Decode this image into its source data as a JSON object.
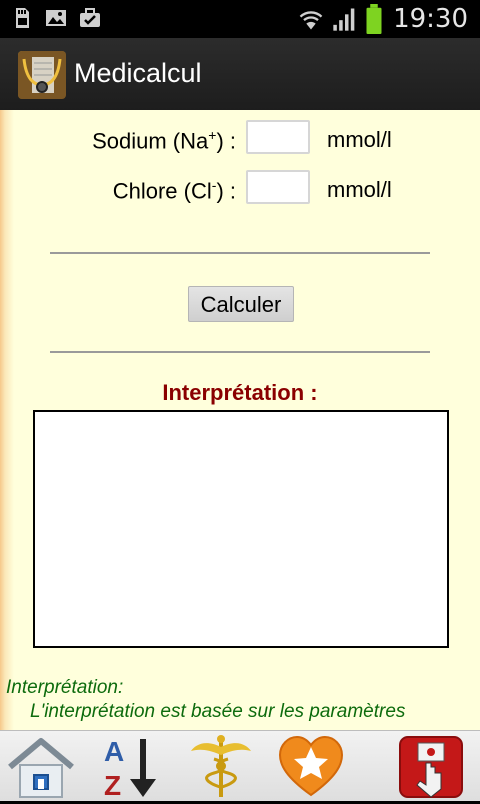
{
  "status_bar": {
    "time": "19:30",
    "icons": [
      "sd-card-icon",
      "image-icon",
      "briefcase-check-icon",
      "wifi-icon",
      "signal-icon",
      "battery-icon"
    ],
    "battery_color": "#7ed321"
  },
  "app": {
    "title": "Medicalcul",
    "logo_icon": "stethoscope-logo-icon"
  },
  "form": {
    "sodium": {
      "label": "Sodium (Na",
      "sup": "+",
      "suffix": ") :",
      "value": "",
      "unit": "mmol/l"
    },
    "chlore": {
      "label": "Chlore (Cl",
      "sup": "-",
      "suffix": ") :",
      "value": "",
      "unit": "mmol/l"
    },
    "calculate_label": "Calculer"
  },
  "interpretation": {
    "title": "Interprétation :",
    "result_text": "",
    "note_heading": "Interprétation:",
    "note_text": "L'interprétation est basée sur les paramètres"
  },
  "bottom_nav": {
    "items": [
      "home-icon",
      "sort-az-icon",
      "caduceus-icon",
      "favorite-heart-icon",
      "exit-icon"
    ]
  },
  "colors": {
    "accent_red": "#8a0000",
    "note_green": "#0d6b0d",
    "content_bg": "#ffffdc"
  }
}
